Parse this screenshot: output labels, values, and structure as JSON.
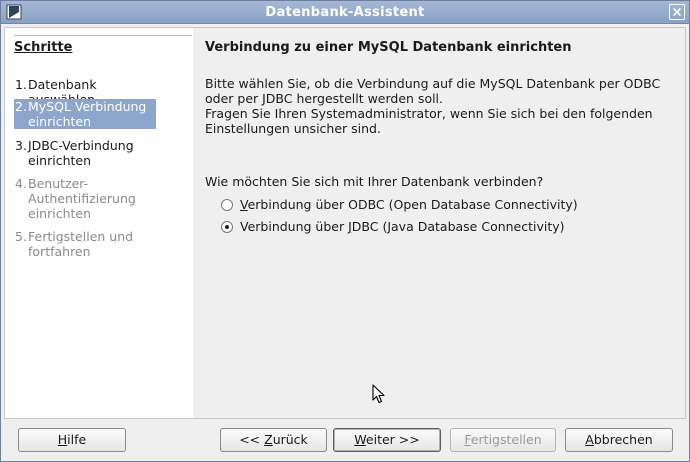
{
  "window": {
    "title": "Datenbank-Assistent"
  },
  "sidebar": {
    "title": "Schritte",
    "steps": [
      {
        "num": "1.",
        "label": "Datenbank auswählen",
        "state": "normal"
      },
      {
        "num": "2.",
        "label": "MySQL Verbindung einrichten",
        "state": "active"
      },
      {
        "num": "3.",
        "label": "JDBC-Verbindung einrichten",
        "state": "normal"
      },
      {
        "num": "4.",
        "label": "Benutzer-Authentifizierung einrichten",
        "state": "disabled"
      },
      {
        "num": "5.",
        "label": "Fertigstellen und fortfahren",
        "state": "disabled"
      }
    ]
  },
  "main": {
    "title": "Verbindung zu einer MySQL Datenbank einrichten",
    "desc_line1": "Bitte wählen Sie, ob die Verbindung auf die MySQL Datenbank per ODBC",
    "desc_line2": "oder per JDBC hergestellt werden soll.",
    "desc_line3": "Fragen Sie Ihren Systemadministrator, wenn Sie sich bei den folgenden",
    "desc_line4": "Einstellungen unsicher sind.",
    "question": "Wie möchten Sie sich mit Ihrer Datenbank verbinden?",
    "options": [
      {
        "pre": "",
        "mnemonic": "V",
        "post": "erbindung über ODBC (Open Database Connectivity)",
        "checked": false
      },
      {
        "pre": "Verbindung über ",
        "mnemonic": "J",
        "post": "DBC (Java Database Connectivity)",
        "checked": true
      }
    ]
  },
  "footer": {
    "help": {
      "mnemonic": "H",
      "rest": "ilfe"
    },
    "back": {
      "pre": "<< ",
      "mnemonic": "Z",
      "rest": "urück"
    },
    "next": {
      "mnemonic": "W",
      "rest": "eiter >>"
    },
    "finish": {
      "mnemonic": "F",
      "rest": "ertigstellen"
    },
    "cancel": {
      "mnemonic": "A",
      "rest": "bbrechen"
    }
  },
  "colors": {
    "titlebar": "#8aa2c6",
    "selection": "#8ea5cb"
  }
}
